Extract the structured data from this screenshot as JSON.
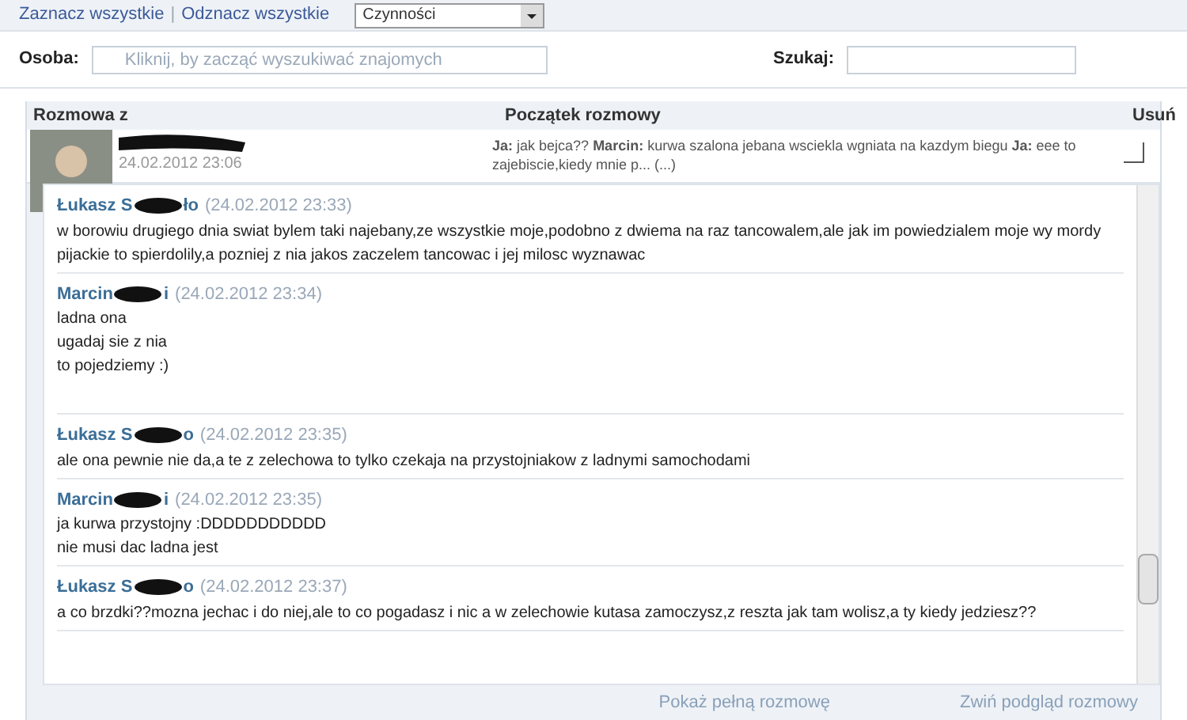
{
  "toolbar": {
    "links": [
      "Zaznacz wszystkie",
      "Odznacz wszystkie"
    ],
    "separator": "|",
    "select": {
      "value": "Czynności"
    }
  },
  "filters": {
    "person": {
      "label": "Osoba:",
      "placeholder": "Kliknij, by zacząć wyszukiwać znajomych"
    },
    "search": {
      "label": "Szukaj:"
    }
  },
  "table": {
    "columns": [
      "Rozmowa z",
      "Początek rozmowy",
      "Usuń"
    ],
    "row": {
      "date": "24.02.2012 23:06",
      "preview": "**Ja:** jak bejca?? **Marcin:** kurwa szalona jebana wsciekla wgniata na kazdym biegu **Ja:** eee to zajebiscie,kiedy mnie p... (...)",
      "checked": false
    }
  },
  "messages": [
    {
      "name_start": "Łukasz S",
      "name_end": "ło",
      "time": "(24.02.2012 23:33)",
      "lines": [
        "w borowiu drugiego dnia swiat bylem taki najebany,ze wszystkie moje,podobno z dwiema na raz tancowalem,ale jak im powiedzialem moje wy mordy pijackie to spierdolily,a pozniej z nia jakos zaczelem tancowac i jej milosc wyznawac"
      ]
    },
    {
      "name_start": "Marcin",
      "name_end": "i",
      "time": "(24.02.2012 23:34)",
      "lines": [
        "ladna ona",
        "ugadaj sie z nia",
        "to pojedziemy :)"
      ]
    },
    {
      "name_start": "Łukasz S",
      "name_end": "o",
      "time": "(24.02.2012 23:35)",
      "lines": [
        "ale ona pewnie nie da,a te z zelechowa to tylko czekaja na przystojniakow z ladnymi samochodami"
      ]
    },
    {
      "name_start": "Marcin",
      "name_end": "i",
      "time": "(24.02.2012 23:35)",
      "lines": [
        "ja kurwa przystojny :DDDDDDDDDDD",
        "nie musi dac ladna jest"
      ]
    },
    {
      "name_start": "Łukasz S",
      "name_end": "o",
      "time": "(24.02.2012 23:37)",
      "lines": [
        "a co brzdki??mozna jechac i do niej,ale to co pogadasz i nic a w zelechowie kutasa zamoczysz,z reszta jak tam wolisz,a ty kiedy jedziesz??"
      ]
    }
  ],
  "footer": {
    "links": [
      "Pokaż pełną rozmowę",
      "Zwiń podgląd rozmowy"
    ]
  }
}
